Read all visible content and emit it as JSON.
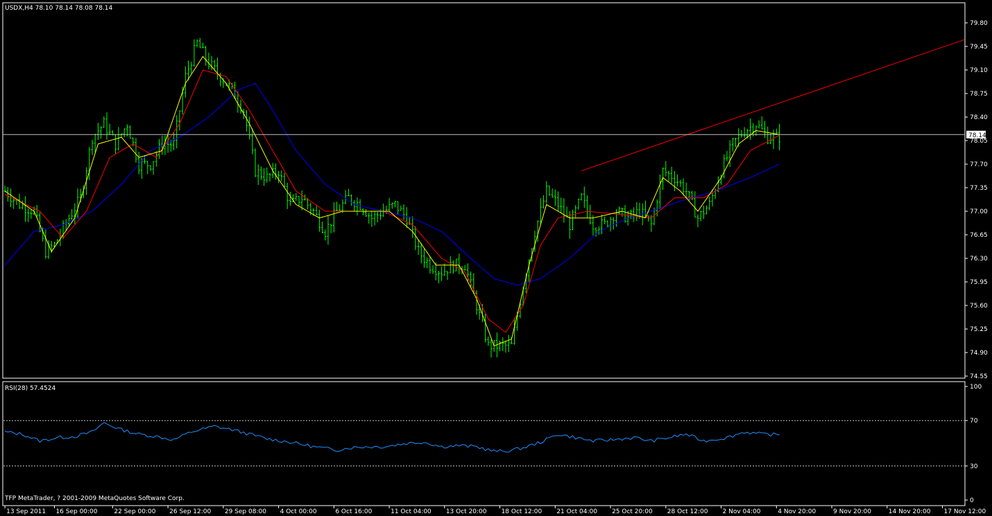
{
  "window": {
    "symbol_header": "USDX,H4  78.10 78.14 78.08 78.14",
    "current_price_label": "78.14",
    "rsi_header": "RSI(28) 57.4524",
    "copyright": "TFP MetaTrader, ? 2001-2009 MetaQuotes Software Corp."
  },
  "colors": {
    "background": "#000000",
    "frame": "#ffffff",
    "candles": "#00ff00",
    "ma_fast": "#ffff00",
    "ma_mid": "#ff0000",
    "ma_slow": "#0000ff",
    "trendline": "#ff0000",
    "rsi_line": "#1e90ff",
    "rsi_levels": "#c0c0c0",
    "price_line": "#c0c0c0"
  },
  "chart_data": [
    {
      "type": "line",
      "title": "USDX,H4  78.10 78.14 78.08 78.14",
      "y_ticks": [
        "79.80",
        "79.45",
        "79.10",
        "78.75",
        "78.40",
        "78.05",
        "77.70",
        "77.35",
        "77.00",
        "76.65",
        "76.30",
        "75.95",
        "75.60",
        "75.25",
        "74.90",
        "74.55"
      ],
      "ylim": [
        74.55,
        79.98
      ],
      "x_ticks": [
        "13 Sep 2011",
        "16 Sep 00:00",
        "22 Sep 00:00",
        "26 Sep 12:00",
        "29 Sep 08:00",
        "4 Oct 00:00",
        "6 Oct 16:00",
        "11 Oct 04:00",
        "13 Oct 20:00",
        "18 Oct 12:00",
        "21 Oct 04:00",
        "25 Oct 20:00",
        "28 Oct 12:00",
        "2 Nov 04:00",
        "4 Nov 20:00",
        "9 Nov 20:00",
        "14 Nov 20:00",
        "17 Nov 12:00"
      ],
      "x_tick_index": [
        0,
        17,
        37,
        56,
        75,
        94,
        113,
        132,
        151,
        170,
        189,
        208,
        227,
        246,
        265,
        284,
        303,
        322
      ],
      "bar_count": 330,
      "close_keypoints": [
        [
          0,
          77.3
        ],
        [
          5,
          77.1
        ],
        [
          10,
          77.0
        ],
        [
          14,
          76.4
        ],
        [
          17,
          76.5
        ],
        [
          22,
          76.9
        ],
        [
          26,
          77.2
        ],
        [
          30,
          78.1
        ],
        [
          34,
          78.3
        ],
        [
          38,
          78.0
        ],
        [
          42,
          78.3
        ],
        [
          46,
          77.7
        ],
        [
          50,
          77.7
        ],
        [
          54,
          78.0
        ],
        [
          58,
          78.0
        ],
        [
          62,
          79.0
        ],
        [
          66,
          79.5
        ],
        [
          70,
          79.2
        ],
        [
          74,
          79.0
        ],
        [
          78,
          78.8
        ],
        [
          82,
          78.5
        ],
        [
          86,
          77.6
        ],
        [
          90,
          77.5
        ],
        [
          94,
          77.6
        ],
        [
          98,
          77.1
        ],
        [
          102,
          77.2
        ],
        [
          106,
          77.0
        ],
        [
          110,
          76.7
        ],
        [
          114,
          77.0
        ],
        [
          118,
          77.2
        ],
        [
          122,
          77.1
        ],
        [
          126,
          76.9
        ],
        [
          130,
          77.0
        ],
        [
          134,
          77.1
        ],
        [
          138,
          76.9
        ],
        [
          142,
          76.4
        ],
        [
          146,
          76.2
        ],
        [
          150,
          76.1
        ],
        [
          154,
          76.2
        ],
        [
          158,
          76.2
        ],
        [
          162,
          75.6
        ],
        [
          166,
          75.0
        ],
        [
          170,
          75.0
        ],
        [
          174,
          75.0
        ],
        [
          178,
          75.9
        ],
        [
          182,
          76.7
        ],
        [
          186,
          77.3
        ],
        [
          190,
          77.1
        ],
        [
          194,
          76.8
        ],
        [
          198,
          77.2
        ],
        [
          202,
          76.8
        ],
        [
          206,
          76.8
        ],
        [
          210,
          77.0
        ],
        [
          214,
          76.9
        ],
        [
          218,
          77.0
        ],
        [
          222,
          76.8
        ],
        [
          226,
          77.6
        ],
        [
          230,
          77.5
        ],
        [
          234,
          77.3
        ],
        [
          238,
          76.9
        ],
        [
          242,
          77.1
        ],
        [
          246,
          77.6
        ],
        [
          250,
          78.0
        ],
        [
          254,
          78.2
        ],
        [
          258,
          78.3
        ],
        [
          262,
          78.1
        ],
        [
          266,
          78.1
        ]
      ],
      "ma_fast_keypoints": [
        [
          0,
          77.3
        ],
        [
          10,
          77.0
        ],
        [
          16,
          76.4
        ],
        [
          24,
          76.9
        ],
        [
          32,
          78.0
        ],
        [
          40,
          78.1
        ],
        [
          46,
          77.8
        ],
        [
          54,
          77.9
        ],
        [
          62,
          78.9
        ],
        [
          68,
          79.3
        ],
        [
          76,
          78.9
        ],
        [
          84,
          78.3
        ],
        [
          92,
          77.6
        ],
        [
          100,
          77.1
        ],
        [
          108,
          76.9
        ],
        [
          116,
          77.0
        ],
        [
          124,
          77.0
        ],
        [
          132,
          77.0
        ],
        [
          140,
          76.7
        ],
        [
          148,
          76.2
        ],
        [
          156,
          76.2
        ],
        [
          162,
          75.7
        ],
        [
          168,
          75.0
        ],
        [
          174,
          75.1
        ],
        [
          180,
          76.2
        ],
        [
          186,
          77.1
        ],
        [
          194,
          76.9
        ],
        [
          202,
          76.9
        ],
        [
          212,
          77.0
        ],
        [
          220,
          76.9
        ],
        [
          226,
          77.5
        ],
        [
          232,
          77.3
        ],
        [
          238,
          77.0
        ],
        [
          246,
          77.5
        ],
        [
          252,
          78.0
        ],
        [
          258,
          78.2
        ],
        [
          266,
          78.14
        ]
      ],
      "ma_mid_keypoints": [
        [
          0,
          77.25
        ],
        [
          12,
          77.0
        ],
        [
          20,
          76.6
        ],
        [
          28,
          77.0
        ],
        [
          36,
          77.8
        ],
        [
          44,
          78.0
        ],
        [
          52,
          77.8
        ],
        [
          60,
          78.3
        ],
        [
          68,
          79.1
        ],
        [
          76,
          79.0
        ],
        [
          84,
          78.5
        ],
        [
          92,
          77.9
        ],
        [
          100,
          77.3
        ],
        [
          110,
          77.0
        ],
        [
          120,
          77.0
        ],
        [
          130,
          77.0
        ],
        [
          140,
          76.8
        ],
        [
          150,
          76.3
        ],
        [
          158,
          76.1
        ],
        [
          166,
          75.4
        ],
        [
          172,
          75.2
        ],
        [
          178,
          75.6
        ],
        [
          184,
          76.5
        ],
        [
          190,
          76.9
        ],
        [
          200,
          77.0
        ],
        [
          212,
          76.95
        ],
        [
          222,
          76.9
        ],
        [
          230,
          77.2
        ],
        [
          240,
          77.2
        ],
        [
          248,
          77.4
        ],
        [
          256,
          77.9
        ],
        [
          266,
          78.13
        ]
      ],
      "ma_slow_keypoints": [
        [
          0,
          76.2
        ],
        [
          10,
          76.7
        ],
        [
          20,
          76.8
        ],
        [
          30,
          77.0
        ],
        [
          40,
          77.4
        ],
        [
          50,
          77.9
        ],
        [
          60,
          78.1
        ],
        [
          70,
          78.4
        ],
        [
          80,
          78.8
        ],
        [
          86,
          78.9
        ],
        [
          92,
          78.5
        ],
        [
          100,
          77.9
        ],
        [
          110,
          77.4
        ],
        [
          120,
          77.1
        ],
        [
          130,
          77.0
        ],
        [
          140,
          76.9
        ],
        [
          150,
          76.7
        ],
        [
          160,
          76.3
        ],
        [
          168,
          76.0
        ],
        [
          176,
          75.9
        ],
        [
          184,
          76.0
        ],
        [
          194,
          76.3
        ],
        [
          204,
          76.7
        ],
        [
          214,
          76.9
        ],
        [
          222,
          77.0
        ],
        [
          232,
          77.15
        ],
        [
          244,
          77.3
        ],
        [
          256,
          77.5
        ],
        [
          266,
          77.7
        ]
      ],
      "trendline": [
        [
          198,
          77.6
        ],
        [
          330,
          79.55
        ]
      ]
    },
    {
      "type": "line",
      "title": "RSI(28) 57.4524",
      "y_ticks": [
        "100",
        "70",
        "30",
        "0"
      ],
      "ylim": [
        0,
        100
      ],
      "levels": [
        70,
        30
      ],
      "rsi_keypoints": [
        [
          0,
          60
        ],
        [
          6,
          58
        ],
        [
          12,
          52
        ],
        [
          18,
          55
        ],
        [
          24,
          56
        ],
        [
          30,
          60
        ],
        [
          34,
          68
        ],
        [
          40,
          62
        ],
        [
          46,
          58
        ],
        [
          52,
          56
        ],
        [
          58,
          53
        ],
        [
          64,
          60
        ],
        [
          72,
          65
        ],
        [
          78,
          62
        ],
        [
          84,
          58
        ],
        [
          90,
          54
        ],
        [
          98,
          51
        ],
        [
          106,
          47
        ],
        [
          114,
          44
        ],
        [
          118,
          46
        ],
        [
          124,
          47
        ],
        [
          130,
          47
        ],
        [
          138,
          50
        ],
        [
          144,
          51
        ],
        [
          150,
          47
        ],
        [
          156,
          48
        ],
        [
          162,
          47
        ],
        [
          168,
          43
        ],
        [
          172,
          43
        ],
        [
          178,
          46
        ],
        [
          184,
          51
        ],
        [
          190,
          58
        ],
        [
          196,
          55
        ],
        [
          202,
          52
        ],
        [
          208,
          53
        ],
        [
          216,
          55
        ],
        [
          222,
          52
        ],
        [
          228,
          55
        ],
        [
          234,
          58
        ],
        [
          240,
          52
        ],
        [
          248,
          55
        ],
        [
          254,
          60
        ],
        [
          260,
          58
        ],
        [
          266,
          57.45
        ]
      ]
    }
  ]
}
